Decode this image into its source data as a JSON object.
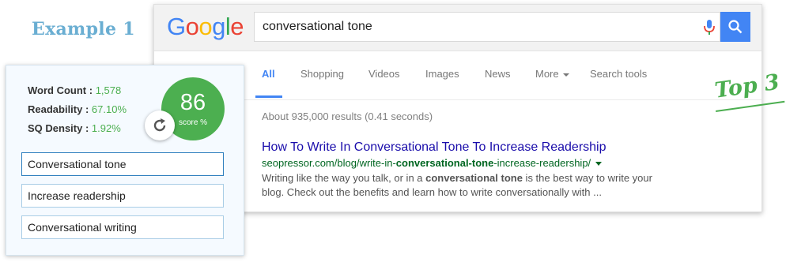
{
  "example_label": "Example 1",
  "google": {
    "logo_letters": [
      {
        "ch": "G",
        "color": "#4285f4"
      },
      {
        "ch": "o",
        "color": "#ea4335"
      },
      {
        "ch": "o",
        "color": "#fbbc05"
      },
      {
        "ch": "g",
        "color": "#4285f4"
      },
      {
        "ch": "l",
        "color": "#34a853"
      },
      {
        "ch": "e",
        "color": "#ea4335"
      }
    ],
    "query": "conversational tone",
    "mic_icon": "microphone-icon",
    "search_icon": "magnifier-icon",
    "tabs": [
      "All",
      "Shopping",
      "Videos",
      "Images",
      "News",
      "More",
      "Search tools"
    ],
    "active_tab": "All",
    "stats": "About 935,000 results (0.41 seconds)",
    "result": {
      "title": "How To Write In Conversational Tone To Increase Readership",
      "url_pre": "seopressor.com/blog/write-in-",
      "url_bold": "conversational-tone",
      "url_post": "-increase-readership/",
      "snippet_1": "Writing like the way you talk, or in a ",
      "snippet_bold": "conversational tone",
      "snippet_2": " is the best way to write your blog. Check out the benefits and learn how to write conversationally with ..."
    }
  },
  "annotation": "Top 3",
  "panel": {
    "word_count_label": "Word Count :",
    "word_count": "1,578",
    "readability_label": "Readability :",
    "readability": "67.10%",
    "sq_label": "SQ Density :",
    "sq_density": "1.92%",
    "score": "86",
    "score_label": "score %",
    "refresh_icon": "refresh-icon",
    "keywords": [
      "Conversational tone",
      "Increase readership",
      "Conversational writing"
    ]
  },
  "colors": {
    "google_blue": "#4285f4",
    "link": "#1a0dab",
    "url_green": "#006621",
    "accent_green": "#4caf50",
    "example_blue": "#6aaed2"
  }
}
